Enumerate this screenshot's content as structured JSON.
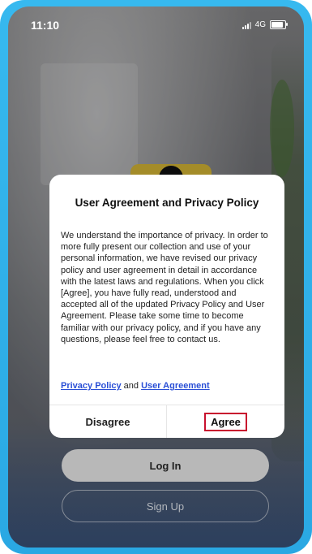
{
  "status_bar": {
    "time": "11:10",
    "network": "4G",
    "icons": [
      "signal-icon",
      "battery-icon"
    ]
  },
  "dialog": {
    "title": "User Agreement and Privacy Policy",
    "body": "We understand the importance of privacy. In order to more fully present our collection and use of your personal information, we have revised our privacy policy and user agreement in detail in accordance with the latest laws and regulations. When you click [Agree], you have fully read, understood and accepted all of the updated Privacy Policy and User Agreement. Please take some time to become familiar with our privacy policy, and if you have any questions, please feel free to contact us.",
    "privacy_link": "Privacy Policy",
    "links_joiner": " and ",
    "agreement_link": "User Agreement",
    "disagree_label": "Disagree",
    "agree_label": "Agree"
  },
  "buttons": {
    "login": "Log In",
    "signup": "Sign Up"
  },
  "colors": {
    "frame": "#2aa8e3",
    "link": "#2a4fd6",
    "highlight": "#c8102e",
    "logo": "#e4c33a"
  }
}
